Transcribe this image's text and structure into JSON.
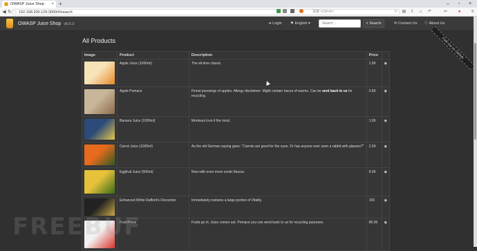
{
  "browser": {
    "tab_title": "OWASP Juice Shop",
    "new_tab": "+",
    "close_tab": "×",
    "window_controls": [
      "–",
      "▫",
      "×"
    ],
    "url": "192.168.200.129:3000/#/search",
    "search_hint": "百度 <Ctrl+K>"
  },
  "app": {
    "title": "OWASP Juice Shop",
    "version": "v6.0.3",
    "nav": {
      "login": "Login",
      "language": "English",
      "search_placeholder": "Search ...",
      "search_button": "Search",
      "contact": "Contact Us",
      "about": "About Us"
    },
    "ribbon": "Fork me on GitHub"
  },
  "page": {
    "title": "All Products",
    "columns": [
      "Image",
      "Product",
      "Description",
      "Price",
      ""
    ],
    "products": [
      {
        "name": "Apple Juice (1000ml)",
        "desc": "The all-time classic.",
        "price": "1.99",
        "image_icon": "apple-juice-image",
        "colors": [
          "#f6e3b8",
          "#e8892a"
        ]
      },
      {
        "name": "Apple Pomace",
        "desc_prefix": "Finest pressings of apples. Allergy disclaimer: Might contain traces of worms. Can be ",
        "desc_bold": "sent back to us",
        "desc_suffix": " for recycling.",
        "price": "0.89",
        "image_icon": "apple-pomace-image",
        "colors": [
          "#c9b69a",
          "#8a6b4a"
        ]
      },
      {
        "name": "Banana Juice (1000ml)",
        "desc": "Monkeys love it the most.",
        "price": "1.99",
        "image_icon": "banana-juice-image",
        "colors": [
          "#2c4a7a",
          "#e7c64a"
        ]
      },
      {
        "name": "Carrot Juice (1000ml)",
        "desc": "As the old German saying goes: \"Carrots are good for the eyes. Or has anyone ever seen a rabbit with glasses?\"",
        "price": "2.99",
        "image_icon": "carrot-juice-image",
        "colors": [
          "#e86a1e",
          "#2f5a1e"
        ]
      },
      {
        "name": "Eggfruit Juice (500ml)",
        "desc": "Now with even more exotic flavour.",
        "price": "8.99",
        "image_icon": "eggfruit-juice-image",
        "colors": [
          "#e5c23a",
          "#3a6a1a"
        ]
      },
      {
        "name": "Enhanced White Rafford's Decoction",
        "desc": "Immediately restores a large portion of Vitality.",
        "price": "150",
        "image_icon": "decoction-image",
        "colors": [
          "#222222",
          "#c9a64a"
        ]
      },
      {
        "name": "Fruit Press",
        "desc": "Fruits go in. Juice comes out. Pomace you can send back to us for recycling purposes.",
        "price": "89.99",
        "image_icon": "fruit-press-image",
        "colors": [
          "#f2f2f2",
          "#d8332a"
        ]
      }
    ]
  },
  "watermark": "FREEBUF"
}
